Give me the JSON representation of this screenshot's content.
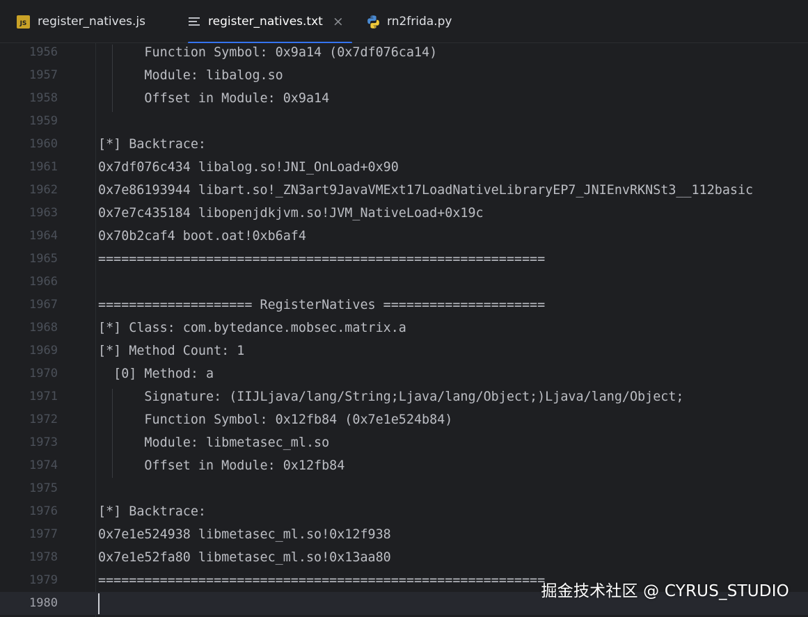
{
  "tabs": [
    {
      "label": "register_natives.js",
      "icon": "js-file-icon"
    },
    {
      "label": "register_natives.txt",
      "icon": "text-file-icon",
      "active": true,
      "close": "×"
    },
    {
      "label": "rn2frida.py",
      "icon": "python-file-icon"
    }
  ],
  "editor": {
    "current_line": "1980",
    "lines": [
      {
        "num": "1956",
        "text": "      Function Symbol: 0x9a14 (0x7df076ca14)"
      },
      {
        "num": "1957",
        "text": "      Module: libalog.so"
      },
      {
        "num": "1958",
        "text": "      Offset in Module: 0x9a14"
      },
      {
        "num": "1959",
        "text": ""
      },
      {
        "num": "1960",
        "text": "[*] Backtrace:"
      },
      {
        "num": "1961",
        "text": "0x7df076c434 libalog.so!JNI_OnLoad+0x90"
      },
      {
        "num": "1962",
        "text": "0x7e86193944 libart.so!_ZN3art9JavaVMExt17LoadNativeLibraryEP7_JNIEnvRKNSt3__112basic"
      },
      {
        "num": "1963",
        "text": "0x7e7c435184 libopenjdkjvm.so!JVM_NativeLoad+0x19c"
      },
      {
        "num": "1964",
        "text": "0x70b2caf4 boot.oat!0xb6af4"
      },
      {
        "num": "1965",
        "text": "=========================================================="
      },
      {
        "num": "1966",
        "text": ""
      },
      {
        "num": "1967",
        "text": "==================== RegisterNatives ====================="
      },
      {
        "num": "1968",
        "text": "[*] Class: com.bytedance.mobsec.matrix.a"
      },
      {
        "num": "1969",
        "text": "[*] Method Count: 1"
      },
      {
        "num": "1970",
        "text": "  [0] Method: a"
      },
      {
        "num": "1971",
        "text": "      Signature: (IIJLjava/lang/String;Ljava/lang/Object;)Ljava/lang/Object;"
      },
      {
        "num": "1972",
        "text": "      Function Symbol: 0x12fb84 (0x7e1e524b84)"
      },
      {
        "num": "1973",
        "text": "      Module: libmetasec_ml.so"
      },
      {
        "num": "1974",
        "text": "      Offset in Module: 0x12fb84"
      },
      {
        "num": "1975",
        "text": ""
      },
      {
        "num": "1976",
        "text": "[*] Backtrace:"
      },
      {
        "num": "1977",
        "text": "0x7e1e524938 libmetasec_ml.so!0x12f938"
      },
      {
        "num": "1978",
        "text": "0x7e1e52fa80 libmetasec_ml.so!0x13aa80"
      },
      {
        "num": "1979",
        "text": "=========================================================="
      },
      {
        "num": "1980",
        "text": ""
      }
    ]
  },
  "watermark": "掘金技术社区 @ CYRUS_STUDIO",
  "colors": {
    "background": "#1e1f22",
    "text": "#bcbec4",
    "line_number": "#4b5059",
    "accent": "#3574f0",
    "js_icon": "#c9a227"
  }
}
